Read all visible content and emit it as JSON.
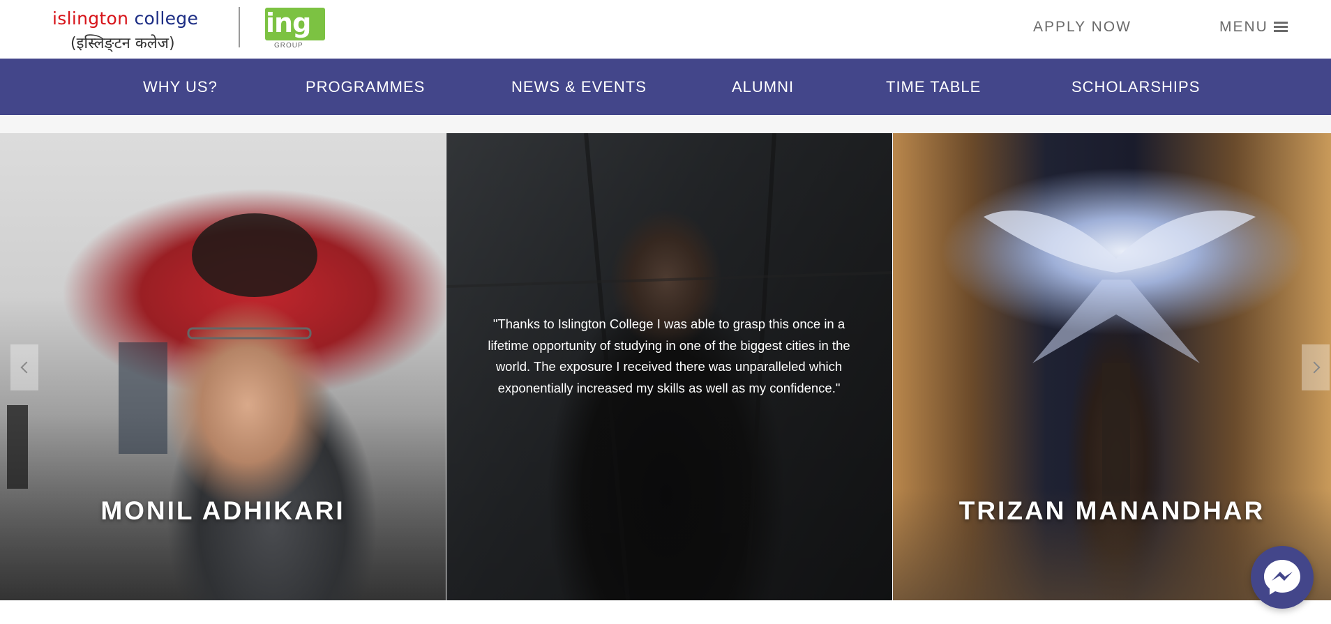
{
  "header": {
    "logo": {
      "brand_i": "i",
      "brand_slington": "slington",
      "brand_college": "college",
      "brand_nepali": "(इस्लिङ्टन कलेज)",
      "group_mark": "ing",
      "group_label": "GROUP"
    },
    "apply_now": "APPLY NOW",
    "menu_label": "MENU",
    "menu_icon": "hamburger-icon"
  },
  "nav": {
    "items": [
      {
        "label": "WHY US?"
      },
      {
        "label": "PROGRAMMES"
      },
      {
        "label": "NEWS & EVENTS"
      },
      {
        "label": "ALUMNI"
      },
      {
        "label": "TIME TABLE"
      },
      {
        "label": "SCHOLARSHIPS"
      }
    ]
  },
  "carousel": {
    "slides": [
      {
        "name": "MONIL ADHIKARI"
      },
      {
        "quote": "\"Thanks to Islington College I was able to grasp this once in a lifetime opportunity of studying in one of the biggest cities in the world. The exposure I received there was unparalleled which exponentially increased my skills as well as my confidence.\""
      },
      {
        "name": "TRIZAN MANANDHAR"
      }
    ],
    "prev_icon": "chevron-left-icon",
    "next_icon": "chevron-right-icon"
  },
  "messenger_icon": "messenger-icon",
  "colors": {
    "nav_bg": "#43468a",
    "brand_red": "#d7141a",
    "brand_blue": "#1c2d84",
    "group_green": "#7cc242"
  }
}
